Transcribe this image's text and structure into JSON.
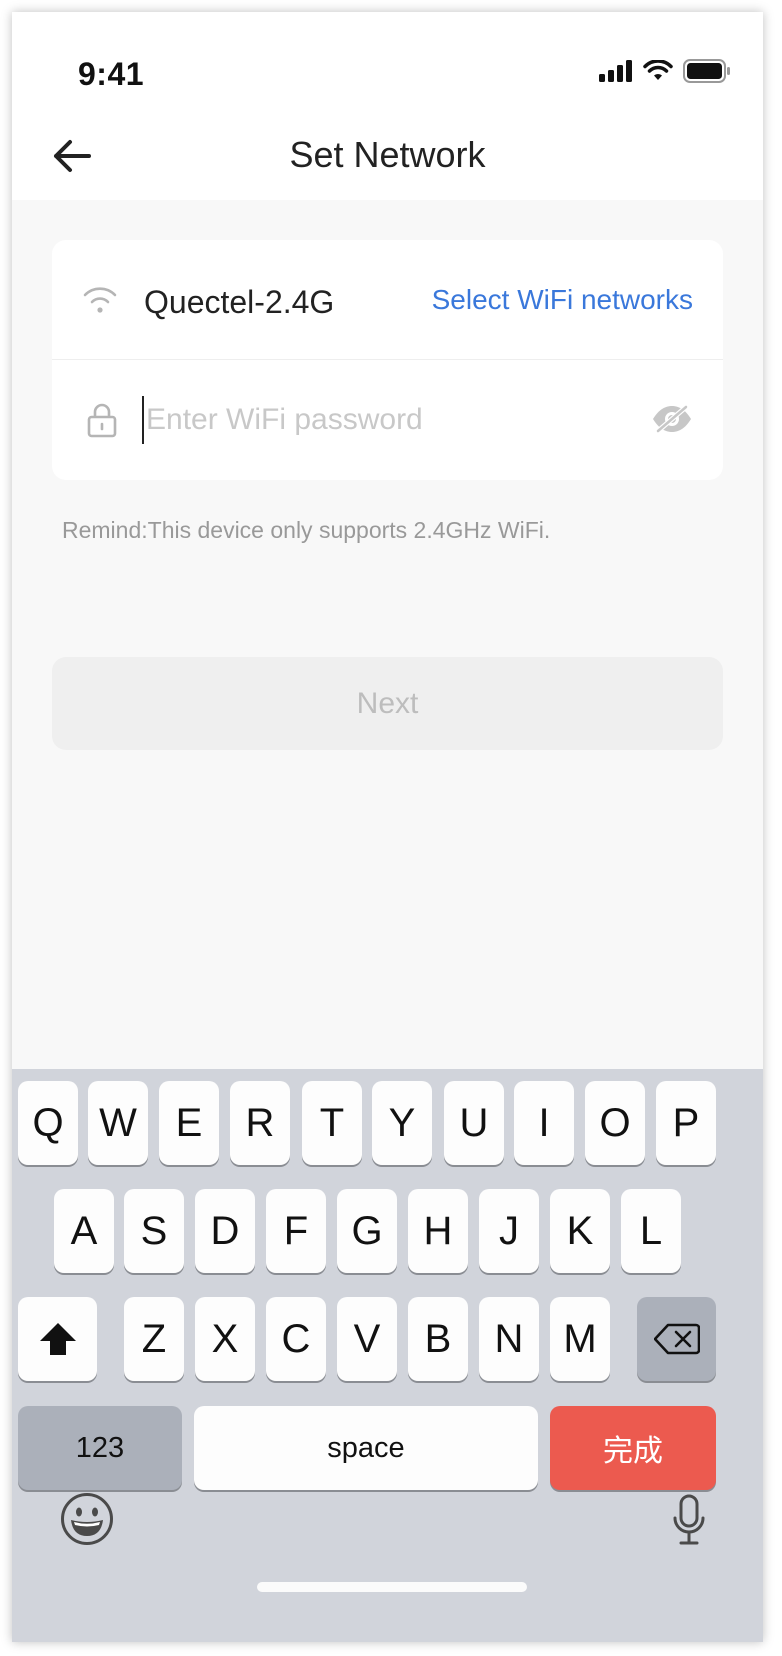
{
  "status_bar": {
    "time": "9:41"
  },
  "nav": {
    "title": "Set Network"
  },
  "wifi": {
    "network_name": "Quectel-2.4G",
    "select_link": "Select WiFi networks"
  },
  "password": {
    "placeholder": "Enter WiFi password",
    "value": ""
  },
  "remind_text": "Remind:This device only supports 2.4GHz WiFi.",
  "next_button": "Next",
  "keyboard": {
    "row1": [
      "Q",
      "W",
      "E",
      "R",
      "T",
      "Y",
      "U",
      "I",
      "O",
      "P"
    ],
    "row2": [
      "A",
      "S",
      "D",
      "F",
      "G",
      "H",
      "J",
      "K",
      "L"
    ],
    "row3": [
      "Z",
      "X",
      "C",
      "V",
      "B",
      "N",
      "M"
    ],
    "numbers_key": "123",
    "space_key": "space",
    "done_key": "完成"
  },
  "colors": {
    "accent_link": "#3a78db",
    "done_key": "#ec5a4f",
    "keyboard_bg": "#d1d4db"
  },
  "icons": {
    "back": "arrow-left-icon",
    "wifi": "wifi-icon",
    "lock": "lock-icon",
    "eye": "eye-off-icon",
    "shift": "shift-icon",
    "delete": "backspace-icon",
    "emoji": "emoji-icon",
    "mic": "mic-icon"
  }
}
